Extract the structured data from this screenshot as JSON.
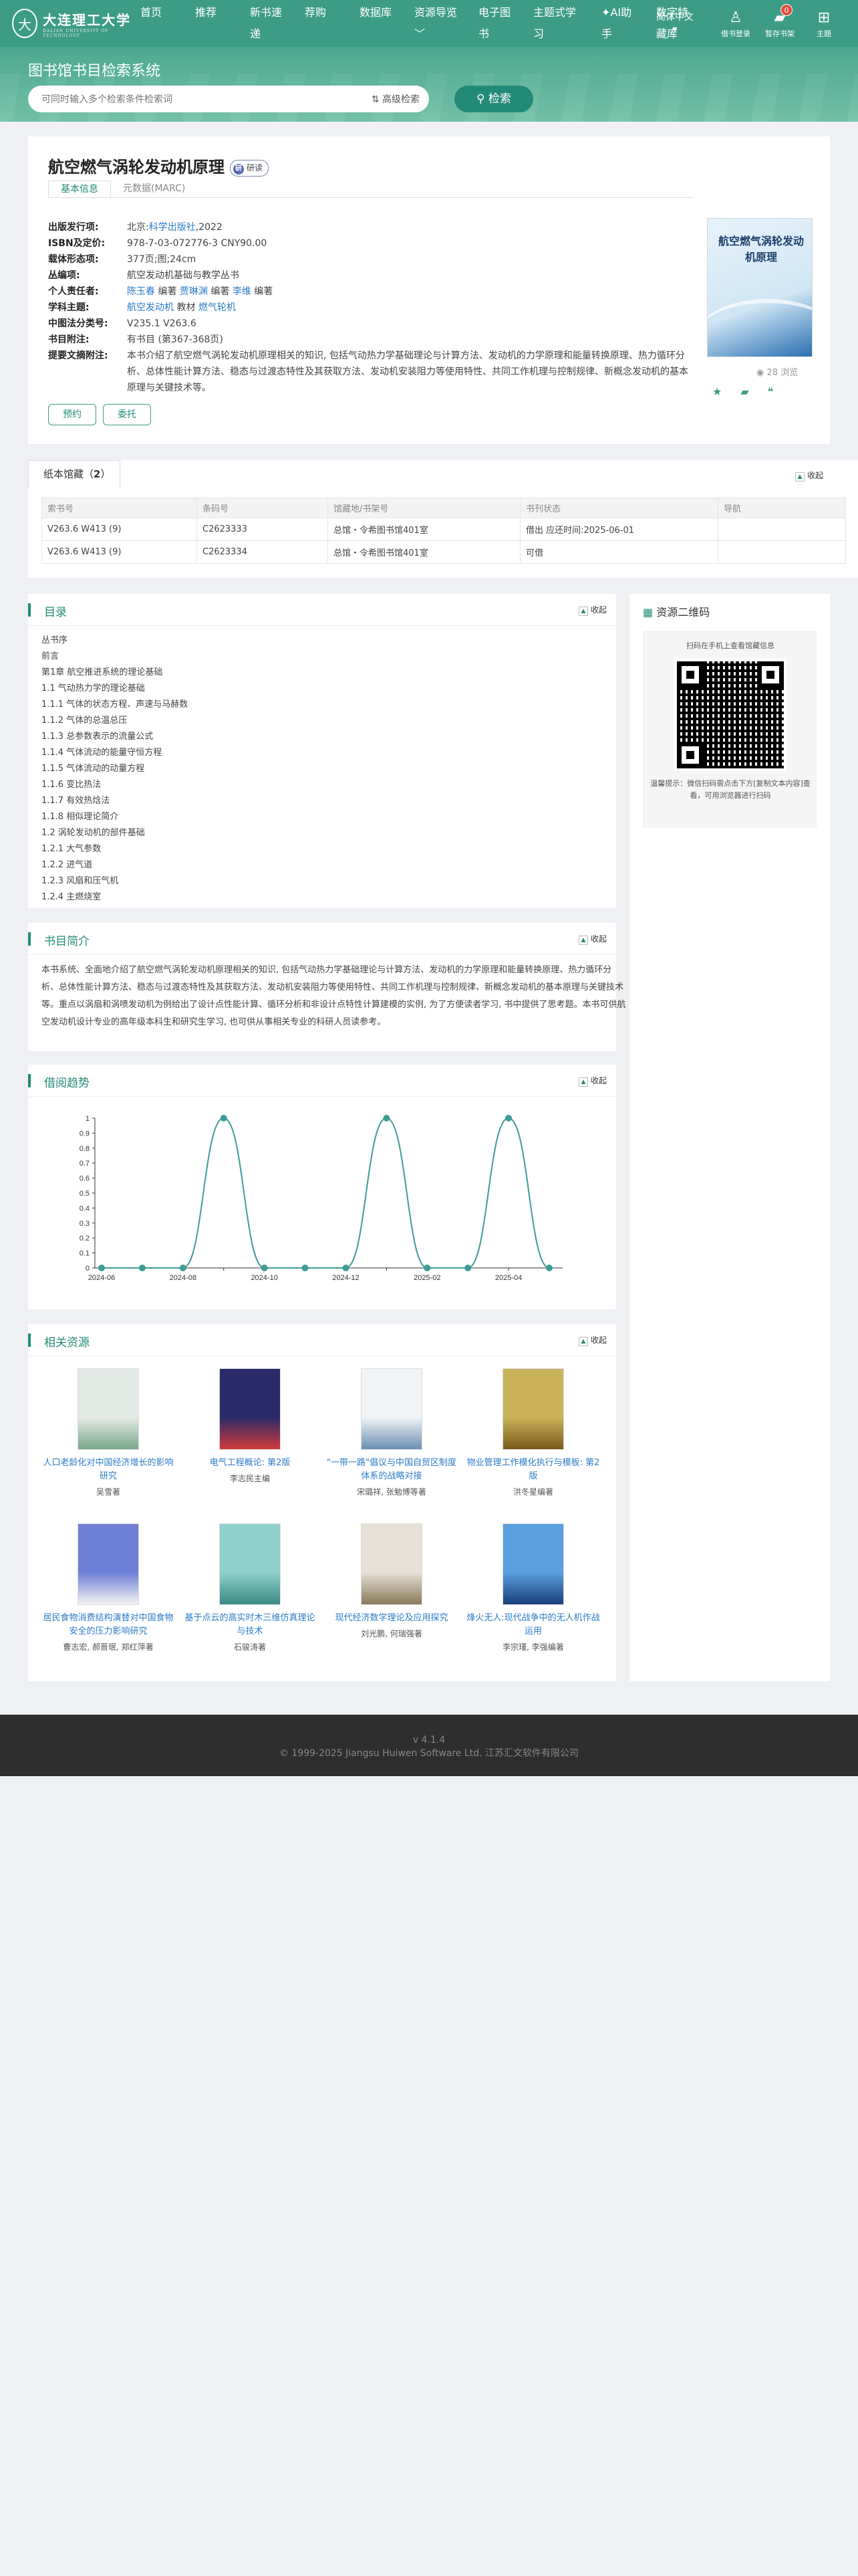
{
  "header": {
    "logo_cn": "大连理工大学",
    "logo_en": "DALIAN UNIVERSITY OF TECHNOLOGY",
    "menu": [
      "首页",
      "推荐",
      "新书速递",
      "荐购",
      "数据库",
      "资源导览",
      "电子图书",
      "主题式学习",
      "AI助手",
      "数字特藏库"
    ],
    "lang": "简体中文",
    "account": "借书登录",
    "shelf": "暂存书架",
    "shelf_count": "0",
    "theme": "主题"
  },
  "hero": {
    "title": "图书馆书目检索系统",
    "placeholder": "可同时输入多个检索条件检索词",
    "advanced": "高级检索",
    "search": "检索"
  },
  "book": {
    "title": "航空燃气涡轮发动机原理",
    "read_tag": "研读",
    "tabs": [
      "基本信息",
      "元数据(MARC)"
    ],
    "fields": [
      {
        "k": "出版发行项:",
        "v": "北京:",
        "link": "科学出版社",
        "v2": ",2022"
      },
      {
        "k": "ISBN及定价:",
        "v": "978-7-03-072776-3 CNY90.00"
      },
      {
        "k": "载体形态项:",
        "v": "377页;图;24cm"
      },
      {
        "k": "丛编项:",
        "v": "航空发动机基础与教学丛书"
      },
      {
        "k": "个人责任者:",
        "parts": [
          [
            "陈玉春",
            "link"
          ],
          [
            " 编著 ",
            ""
          ],
          [
            "贾琳渊",
            "link"
          ],
          [
            " 编著 ",
            ""
          ],
          [
            "李维",
            "link"
          ],
          [
            " 编著",
            ""
          ]
        ]
      },
      {
        "k": "学科主题:",
        "parts": [
          [
            "航空发动机",
            "link"
          ],
          [
            " 教材 ",
            ""
          ],
          [
            "燃气轮机",
            "link"
          ]
        ]
      },
      {
        "k": "中图法分类号:",
        "v": "V235.1 V263.6"
      },
      {
        "k": "书目附注:",
        "v": "有书目 (第367-368页)"
      },
      {
        "k": "提要文摘附注:",
        "v": "本书介绍了航空燃气涡轮发动机原理相关的知识, 包括气动热力学基础理论与计算方法、发动机的力学原理和能量转换原理、热力循环分析、总体性能计算方法、稳态与过渡态特性及其获取方法、发动机安装阻力等使用特性、共同工作机理与控制规律、新概念发动机的基本原理与关键技术等。"
      }
    ],
    "reserve": "预约",
    "commission": "委托",
    "cover_title": "航空燃气涡轮发动机原理",
    "views": "28 浏览"
  },
  "holdings": {
    "tab": "纸本馆藏",
    "count": "2",
    "collapse": "收起",
    "columns": [
      "索书号",
      "条码号",
      "馆藏地/书架号",
      "书刊状态",
      "导航"
    ],
    "rows": [
      {
        "call": "V263.6 W413 (9)",
        "barcode": "C2623333",
        "loc": "总馆・令希图书馆401室",
        "status": "借出 应还时间:2025-06-01",
        "ok": false
      },
      {
        "call": "V263.6 W413 (9)",
        "barcode": "C2623334",
        "loc": "总馆・令希图书馆401室",
        "status": "可借",
        "ok": true
      }
    ]
  },
  "toc": {
    "title": "目录",
    "collapse": "收起",
    "items": [
      "丛书序",
      "前言",
      "第1章 航空推进系统的理论基础",
      "1.1 气动热力学的理论基础",
      "1.1.1 气体的状态方程、声速与马赫数",
      "1.1.2 气体的总温总压",
      "1.1.3 总参数表示的流量公式",
      "1.1.4 气体流动的能量守恒方程",
      "1.1.5 气体流动的动量方程",
      "1.1.6 变比热法",
      "1.1.7 有效热焓法",
      "1.1.8 相似理论简介",
      "1.2 涡轮发动机的部件基础",
      "1.2.1 大气参数",
      "1.2.2 进气道",
      "1.2.3 风扇和压气机",
      "1.2.4 主燃烧室"
    ]
  },
  "qr": {
    "title": "资源二维码",
    "tip": "扫码在手机上查看馆藏信息",
    "note": "温馨提示：微信扫码需点击下方[复制文本内容]查看，可用浏览器进行扫码"
  },
  "intro": {
    "title": "书目简介",
    "collapse": "收起",
    "text": "本书系统、全面地介绍了航空燃气涡轮发动机原理相关的知识, 包括气动热力学基础理论与计算方法、发动机的力学原理和能量转换原理、热力循环分析、总体性能计算方法、稳态与过渡态特性及其获取方法、发动机安装阻力等使用特性、共同工作机理与控制规律、新概念发动机的基本原理与关键技术等。重点以涡扇和涡喷发动机为例给出了设计点性能计算、循环分析和非设计点特性计算建模的实例, 为了方便读者学习, 书中提供了思考题。本书可供航空发动机设计专业的高年级本科生和研究生学习, 也可供从事相关专业的科研人员读参考。"
  },
  "trend": {
    "title": "借阅趋势",
    "collapse": "收起"
  },
  "chart_data": {
    "type": "line",
    "x": [
      "2024-06",
      "2024-07",
      "2024-08",
      "2024-09",
      "2024-10",
      "2024-11",
      "2024-12",
      "2025-01",
      "2025-02",
      "2025-03",
      "2025-04",
      "2025-05"
    ],
    "x_tick_labels": [
      "2024-06",
      "2024-08",
      "2024-10",
      "2024-12",
      "2025-02",
      "2025-04"
    ],
    "values": [
      0,
      0,
      0,
      1,
      0,
      0,
      0,
      1,
      0,
      0,
      1,
      0
    ],
    "ylim": [
      0,
      1
    ],
    "yticks": [
      "0",
      "0.1",
      "0.2",
      "0.3",
      "0.4",
      "0.5",
      "0.6",
      "0.7",
      "0.8",
      "0.9",
      "1"
    ],
    "color": "#3d9c96"
  },
  "related": {
    "title": "相关资源",
    "collapse": "收起",
    "items": [
      {
        "title": "人口老龄化对中国经济增长的影响研究",
        "author": "吴雪著",
        "color": "#e4ebe6",
        "accent": "#7aa88a"
      },
      {
        "title": "电气工程概论: 第2版",
        "author": "李志民主编",
        "color": "#2a2a6b",
        "accent": "#d03a3a"
      },
      {
        "title": "\"一带一路\"倡议与中国自贸区制度体系的战略对接",
        "author": "宋璐祥, 张勉博等著",
        "color": "#f2f5f7",
        "accent": "#6b8fb0"
      },
      {
        "title": "物业管理工作模化执行与模板: 第2版",
        "author": "洪冬星编著",
        "color": "#c9b25a",
        "accent": "#7a5a1a"
      },
      {
        "title": "居民食物消费结构演替对中国食物安全的压力影响研究",
        "author": "曹志宏, 郝晋珉, 郑红萍著",
        "color": "#6e7fd6",
        "accent": "#f2f2f2"
      },
      {
        "title": "基于点云的高实时木三维仿真理论与技术",
        "author": "石骏涛著",
        "color": "#8fd0cc",
        "accent": "#3a8a86"
      },
      {
        "title": "现代经济数学理论及应用探究",
        "author": "刘光鹏, 何瑞强著",
        "color": "#e6e1d6",
        "accent": "#8a7a5a"
      },
      {
        "title": "烽火无人:现代战争中的无人机作战运用",
        "author": "李宗瑾, 李强编著",
        "color": "#5aa0e0",
        "accent": "#1a3f7a"
      }
    ]
  },
  "footer": {
    "version": "v 4.1.4",
    "copyright": "© 1999-2025 Jiangsu Huiwen Software Ltd. 江苏汇文软件有限公司"
  }
}
